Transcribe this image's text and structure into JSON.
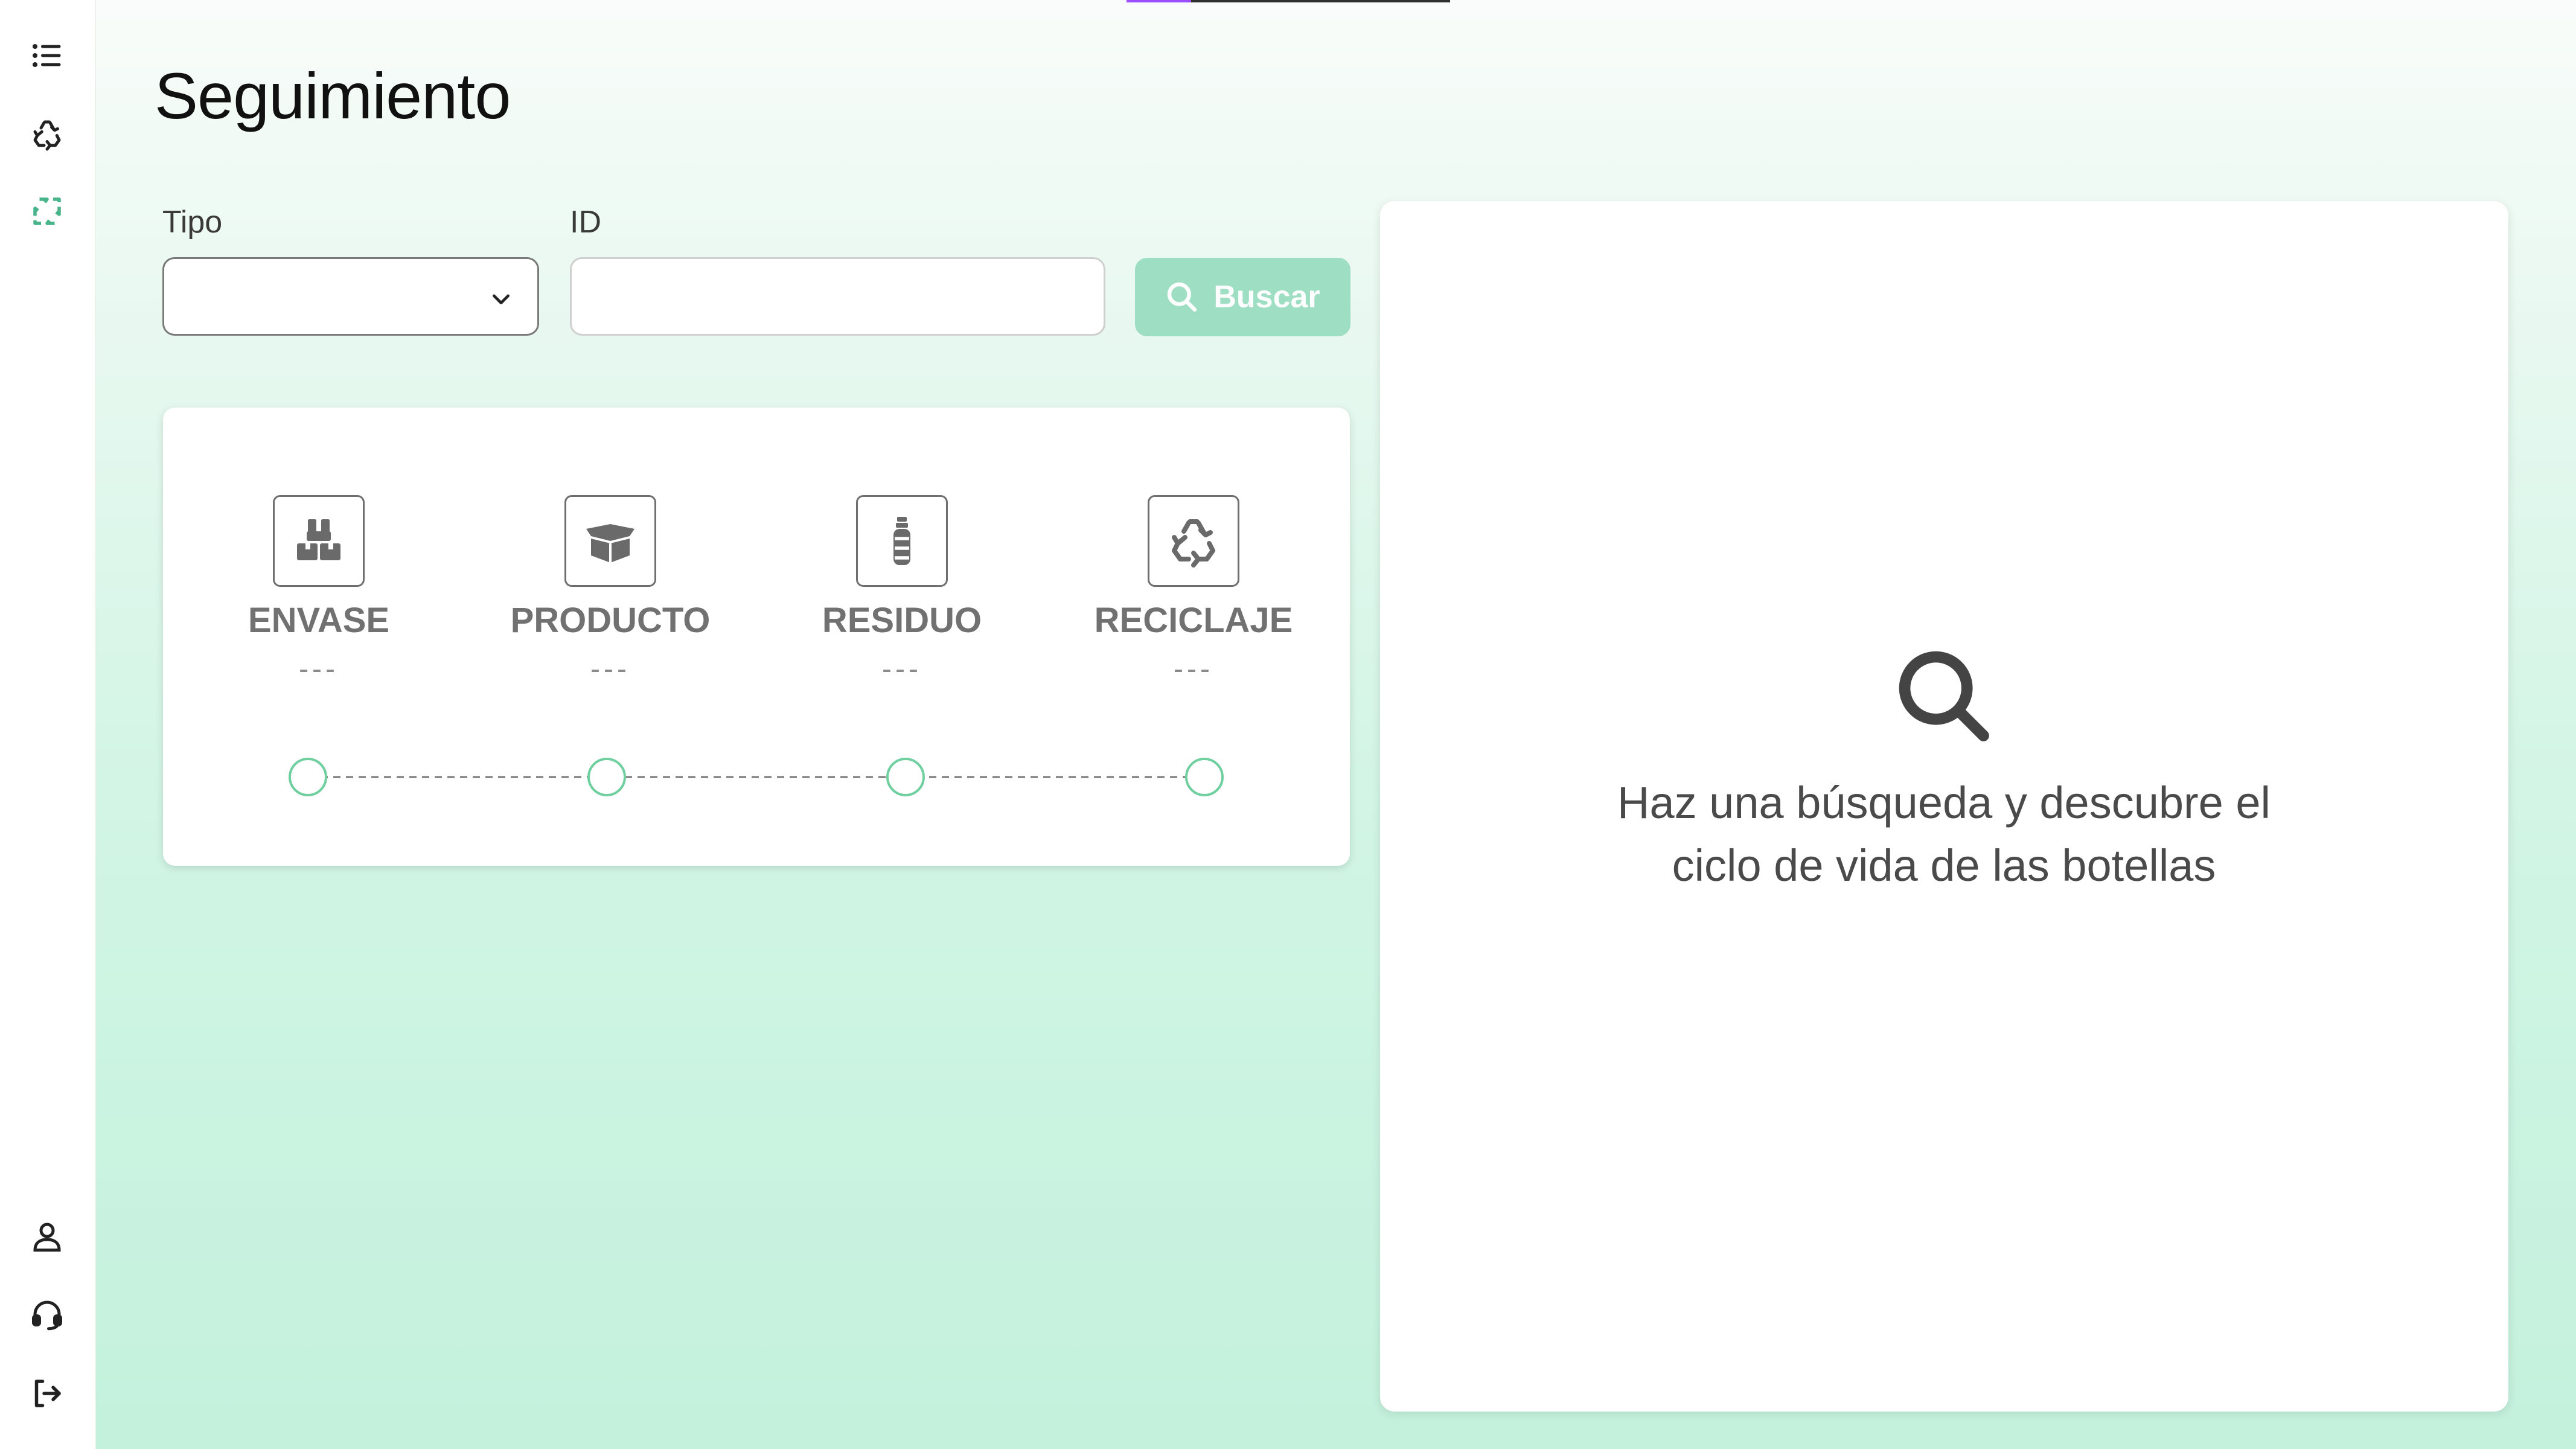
{
  "page": {
    "title": "Seguimiento",
    "accent_color": "#6fcf9f",
    "button_color": "#9edec2",
    "progress": 0.2
  },
  "sidebar": {
    "top_items": [
      {
        "icon": "list-icon"
      },
      {
        "icon": "recycle-icon"
      },
      {
        "icon": "tracking-recycle-icon",
        "active": true
      }
    ],
    "bottom_items": [
      {
        "icon": "user-icon"
      },
      {
        "icon": "headset-icon"
      },
      {
        "icon": "logout-icon"
      }
    ]
  },
  "search_form": {
    "tipo_label": "Tipo",
    "tipo_value": "",
    "id_label": "ID",
    "id_value": "",
    "id_placeholder": "",
    "search_label": "Buscar"
  },
  "steps": [
    {
      "label": "ENVASE",
      "value": "---",
      "icon": "boxes-icon"
    },
    {
      "label": "PRODUCTO",
      "value": "---",
      "icon": "open-box-icon"
    },
    {
      "label": "RESIDUO",
      "value": "---",
      "icon": "bottle-icon"
    },
    {
      "label": "RECICLAJE",
      "value": "---",
      "icon": "recycle-icon"
    }
  ],
  "info_panel": {
    "message": "Haz una búsqueda y descubre el ciclo de vida de las botellas",
    "icon": "search-icon"
  }
}
